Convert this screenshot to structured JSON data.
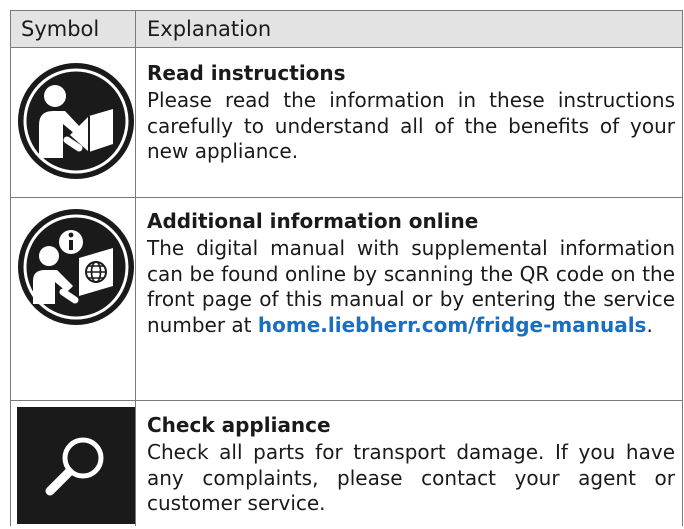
{
  "header": {
    "symbol_label": "Symbol",
    "explanation_label": "Explanation"
  },
  "rows": [
    {
      "icon": "read-instructions-icon",
      "title": "Read instructions",
      "text": "Please read the information in these instructions carefully to understand all of the benefits of your new appliance."
    },
    {
      "icon": "additional-information-online-icon",
      "title": "Additional information online",
      "text": "The digital manual with supplemental information can be found online by scanning the QR code on the front page of this manual or by entering the service number at ",
      "link": "home.liebherr.com/fridge-manuals",
      "text_end": "."
    },
    {
      "icon": "magnifying-glass-icon",
      "title": "Check appliance",
      "text": "Check all parts for transport damage. If you have any complaints, please contact your agent or customer service."
    }
  ],
  "colors": {
    "header_bg": "#e3e3e3",
    "link": "#1a6fc0",
    "icon": "#1a1a1a"
  }
}
